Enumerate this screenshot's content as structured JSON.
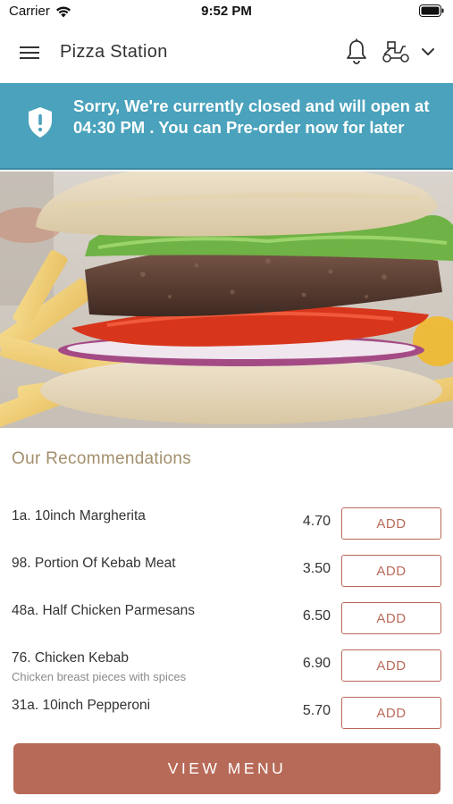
{
  "status_bar": {
    "carrier": "Carrier",
    "time": "9:52 PM"
  },
  "nav": {
    "title": "Pizza Station",
    "icons": [
      "menu-icon",
      "bell-icon",
      "scooter-icon",
      "chevron-down-icon"
    ]
  },
  "banner": {
    "message": "Sorry, We're currently closed and will open at 04:30 PM . You can Pre-order now for later",
    "color": "#4aa2bc",
    "icon": "shield-alert-icon"
  },
  "recommendations": {
    "title": "Our Recommendations",
    "items": [
      {
        "name": "1a. 10inch Margherita",
        "desc": "",
        "price": "4.70",
        "action": "ADD"
      },
      {
        "name": "98. Portion Of Kebab Meat",
        "desc": "",
        "price": "3.50",
        "action": "ADD"
      },
      {
        "name": "48a. Half Chicken Parmesans",
        "desc": "",
        "price": "6.50",
        "action": "ADD"
      },
      {
        "name": "76. Chicken Kebab",
        "desc": "Chicken breast pieces with spices",
        "price": "6.90",
        "action": "ADD"
      },
      {
        "name": "31a. 10inch Pepperoni",
        "desc": "",
        "price": "5.70",
        "action": "ADD"
      }
    ]
  },
  "footer": {
    "view_menu_label": "VIEW MENU",
    "accent_color": "#b86a58"
  }
}
